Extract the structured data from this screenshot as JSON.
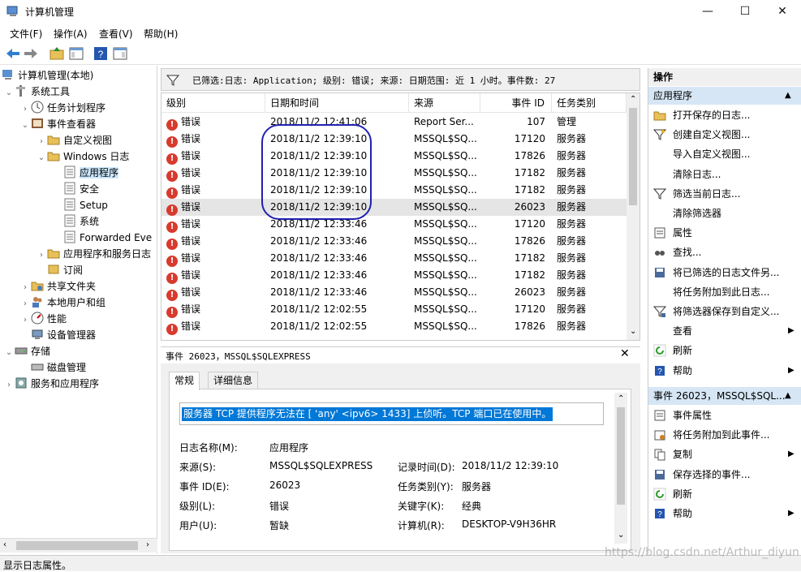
{
  "window": {
    "title": "计算机管理",
    "min_symbol": "—",
    "max_symbol": "☐",
    "close_symbol": "✕"
  },
  "menu": [
    "文件(F)",
    "操作(A)",
    "查看(V)",
    "帮助(H)"
  ],
  "tree": [
    {
      "label": "计算机管理(本地)",
      "icon": "computer-icon"
    },
    {
      "label": "系统工具",
      "icon": "tools-icon"
    },
    {
      "label": "任务计划程序",
      "icon": "clock-icon"
    },
    {
      "label": "事件查看器",
      "icon": "event-viewer-icon"
    },
    {
      "label": "自定义视图",
      "icon": "folder-icon"
    },
    {
      "label": "Windows 日志",
      "icon": "folder-icon"
    },
    {
      "label": "应用程序",
      "icon": "log-icon"
    },
    {
      "label": "安全",
      "icon": "log-icon"
    },
    {
      "label": "Setup",
      "icon": "log-icon"
    },
    {
      "label": "系统",
      "icon": "log-icon"
    },
    {
      "label": "Forwarded Eve",
      "icon": "log-icon"
    },
    {
      "label": "应用程序和服务日志",
      "icon": "folder-icon"
    },
    {
      "label": "订阅",
      "icon": "subscription-icon"
    },
    {
      "label": "共享文件夹",
      "icon": "shared-folder-icon"
    },
    {
      "label": "本地用户和组",
      "icon": "users-icon"
    },
    {
      "label": "性能",
      "icon": "performance-icon"
    },
    {
      "label": "设备管理器",
      "icon": "device-manager-icon"
    },
    {
      "label": "存储",
      "icon": "storage-icon"
    },
    {
      "label": "磁盘管理",
      "icon": "disk-icon"
    },
    {
      "label": "服务和应用程序",
      "icon": "services-icon"
    }
  ],
  "filter": {
    "text": "已筛选:日志: Application; 级别: 错误; 来源: 日期范围: 近 1 小时。事件数: 27"
  },
  "grid": {
    "columns": [
      "级别",
      "日期和时间",
      "来源",
      "事件 ID",
      "任务类别"
    ],
    "rows": [
      [
        "错误",
        "2018/11/2 12:41:06",
        "Report Ser...",
        "107",
        "管理"
      ],
      [
        "错误",
        "2018/11/2 12:39:10",
        "MSSQL$SQ...",
        "17120",
        "服务器"
      ],
      [
        "错误",
        "2018/11/2 12:39:10",
        "MSSQL$SQ...",
        "17826",
        "服务器"
      ],
      [
        "错误",
        "2018/11/2 12:39:10",
        "MSSQL$SQ...",
        "17182",
        "服务器"
      ],
      [
        "错误",
        "2018/11/2 12:39:10",
        "MSSQL$SQ...",
        "17182",
        "服务器"
      ],
      [
        "错误",
        "2018/11/2 12:39:10",
        "MSSQL$SQ...",
        "26023",
        "服务器"
      ],
      [
        "错误",
        "2018/11/2 12:33:46",
        "MSSQL$SQ...",
        "17120",
        "服务器"
      ],
      [
        "错误",
        "2018/11/2 12:33:46",
        "MSSQL$SQ...",
        "17826",
        "服务器"
      ],
      [
        "错误",
        "2018/11/2 12:33:46",
        "MSSQL$SQ...",
        "17182",
        "服务器"
      ],
      [
        "错误",
        "2018/11/2 12:33:46",
        "MSSQL$SQ...",
        "17182",
        "服务器"
      ],
      [
        "错误",
        "2018/11/2 12:33:46",
        "MSSQL$SQ...",
        "26023",
        "服务器"
      ],
      [
        "错误",
        "2018/11/2 12:02:55",
        "MSSQL$SQ...",
        "17120",
        "服务器"
      ],
      [
        "错误",
        "2018/11/2 12:02:55",
        "MSSQL$SQ...",
        "17826",
        "服务器"
      ]
    ]
  },
  "detail": {
    "title": "事件 26023，MSSQL$SQLEXPRESS",
    "tabs": [
      "常规",
      "详细信息"
    ],
    "message": "服务器 TCP 提供程序无法在 [ 'any' <ipv6> 1433] 上侦听。TCP 端口已在使用中。",
    "fields": {
      "log_name_label": "日志名称(M):",
      "log_name": "应用程序",
      "source_label": "来源(S):",
      "source": "MSSQL$SQLEXPRESS",
      "logged_label": "记录时间(D):",
      "logged": "2018/11/2 12:39:10",
      "event_id_label": "事件 ID(E):",
      "event_id": "26023",
      "task_label": "任务类别(Y):",
      "task": "服务器",
      "level_label": "级别(L):",
      "level": "错误",
      "keywords_label": "关键字(K):",
      "keywords": "经典",
      "user_label": "用户(U):",
      "user": "暂缺",
      "computer_label": "计算机(R):",
      "computer": "DESKTOP-V9H36HR"
    }
  },
  "actions": {
    "header": "操作",
    "section1": "应用程序",
    "items1": [
      {
        "label": "打开保存的日志...",
        "icon": "open-folder-icon"
      },
      {
        "label": "创建自定义视图...",
        "icon": "filter-create-icon"
      },
      {
        "label": "导入自定义视图...",
        "icon": ""
      },
      {
        "label": "清除日志...",
        "icon": ""
      },
      {
        "label": "筛选当前日志...",
        "icon": "filter-icon"
      },
      {
        "label": "清除筛选器",
        "icon": ""
      },
      {
        "label": "属性",
        "icon": "properties-icon"
      },
      {
        "label": "查找...",
        "icon": "find-icon"
      },
      {
        "label": "将已筛选的日志文件另...",
        "icon": "save-icon"
      },
      {
        "label": "将任务附加到此日志...",
        "icon": ""
      },
      {
        "label": "将筛选器保存到自定义...",
        "icon": "filter-save-icon"
      },
      {
        "label": "查看",
        "icon": "",
        "submenu": true
      },
      {
        "label": "刷新",
        "icon": "refresh-icon"
      },
      {
        "label": "帮助",
        "icon": "help-icon",
        "submenu": true
      }
    ],
    "section2": "事件 26023，MSSQL$SQL...",
    "items2": [
      {
        "label": "事件属性",
        "icon": "event-properties-icon"
      },
      {
        "label": "将任务附加到此事件...",
        "icon": "attach-task-icon"
      },
      {
        "label": "复制",
        "icon": "copy-icon",
        "submenu": true
      },
      {
        "label": "保存选择的事件...",
        "icon": "save-icon"
      },
      {
        "label": "刷新",
        "icon": "refresh-icon"
      },
      {
        "label": "帮助",
        "icon": "help-icon",
        "submenu": true
      }
    ]
  },
  "status": "显示日志属性。",
  "watermark": "https://blog.csdn.net/Arthur_diyun",
  "colors": {
    "selection": "#0078d7",
    "error": "#d83a2e",
    "annotation": "#2020b0"
  }
}
